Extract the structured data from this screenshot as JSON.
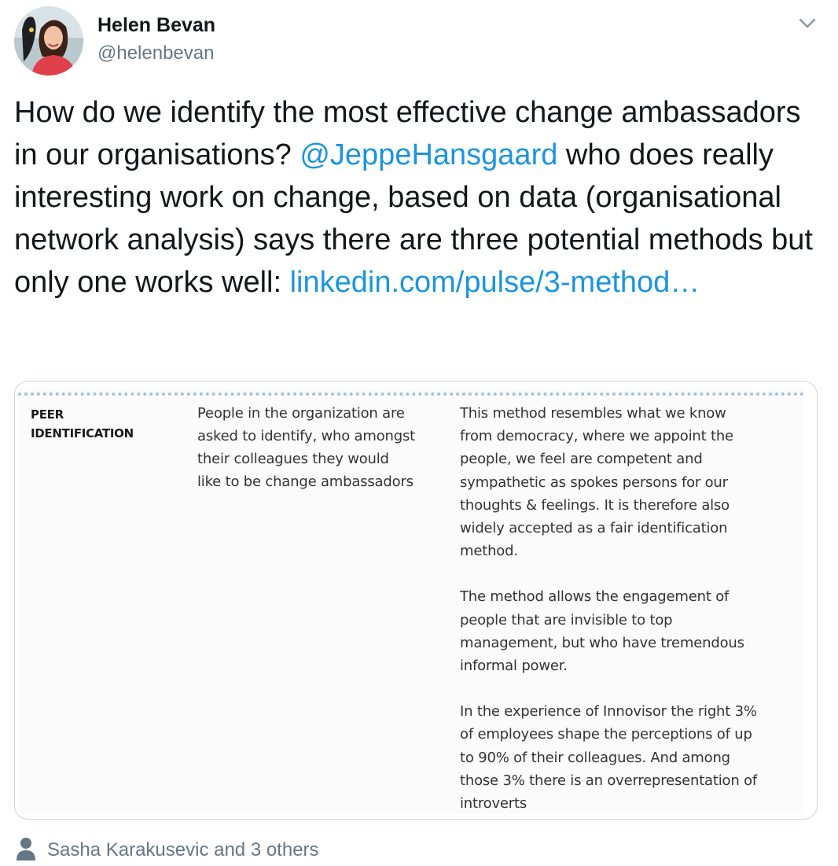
{
  "author": {
    "name": "Helen Bevan",
    "handle": "@helenbevan"
  },
  "tweet": {
    "text_1": "How do we identify the most effective change ambassadors in our organisations? ",
    "mention": "@JeppeHansgaard",
    "text_2": " who does really interesting work on change, based on data (organisational network analysis) says there are three potential methods but only one works well: ",
    "link": "linkedin.com/pulse/3-method…"
  },
  "media": {
    "label_line1": "PEER",
    "label_line2": "IDENTIFICATION",
    "description": "People in the organization are\nasked to identify, who amongst\ntheir colleagues they would\nlike to be change ambassadors",
    "paragraphs": [
      "This method resembles what we know\nfrom democracy, where we appoint the\npeople, we feel are competent and\nsympathetic as spokes persons for our\nthoughts & feelings. It is therefore also\nwidely accepted as a fair identification\nmethod.",
      "The method allows the engagement of\npeople that are invisible to top\nmanagement, but who have tremendous\ninformal power.",
      "In the experience of Innovisor the right 3%\nof employees shape the perceptions of up\nto 90% of their colleagues. And among\nthose 3% there is an overrepresentation of\nintroverts"
    ]
  },
  "likes": {
    "text": "Sasha Karakusevic and 3 others"
  },
  "icons": {
    "caret": "chevron-down-icon",
    "person": "person-icon"
  },
  "colors": {
    "link": "#1b95e0",
    "secondary_text": "#657786",
    "border": "#ccd6dd",
    "dotted_rule": "#9dc3e6"
  }
}
